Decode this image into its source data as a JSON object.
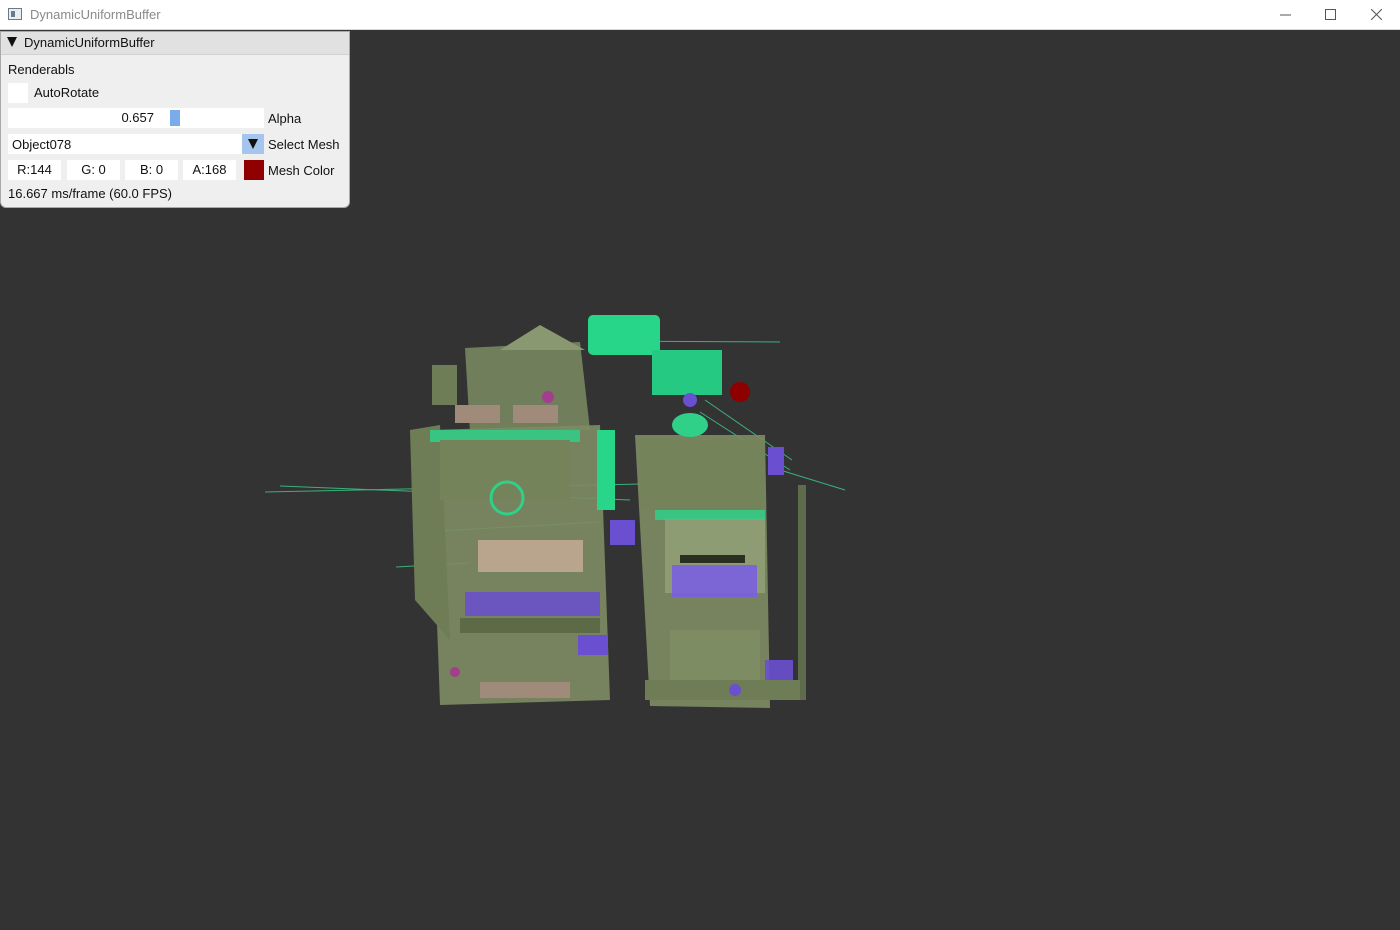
{
  "window": {
    "title": "DynamicUniformBuffer",
    "icons": [
      "app-icon",
      "minimize-icon",
      "maximize-icon",
      "close-icon"
    ]
  },
  "panel": {
    "title": "DynamicUniformBuffer",
    "section_label": "Renderabls",
    "auto_rotate": {
      "label": "AutoRotate",
      "checked": false
    },
    "alpha": {
      "value": 0.657,
      "value_text": "0.657",
      "label": "Alpha"
    },
    "mesh_select": {
      "value": "Object078",
      "label": "Select Mesh"
    },
    "mesh_color": {
      "r": "R:144",
      "g": "G:  0",
      "b": "B:  0",
      "a": "A:168",
      "label": "Mesh Color",
      "swatch": "#900000"
    },
    "fps_text": "16.667 ms/frame (60.0 FPS)"
  },
  "colors": {
    "viewport_bg": "#333333",
    "accent": "#7aabea",
    "panel_bg": "#efefef"
  }
}
